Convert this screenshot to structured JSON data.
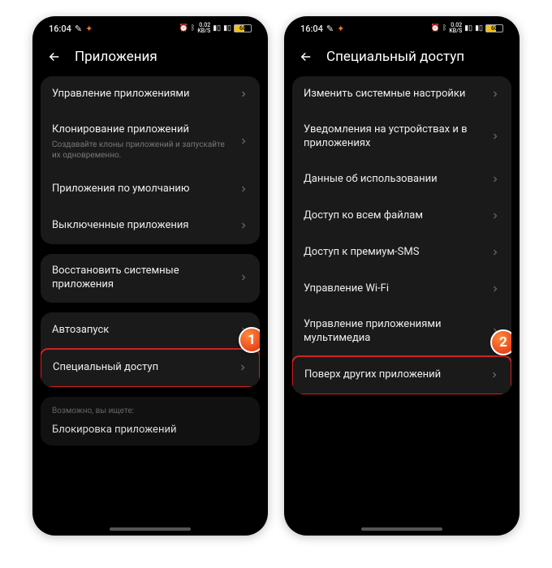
{
  "status": {
    "time": "16:04",
    "speed_top": "0.02",
    "speed_bot": "KB/S",
    "battery": "60"
  },
  "screen1": {
    "title": "Приложения",
    "group1": [
      {
        "label": "Управление приложениями"
      },
      {
        "label": "Клонирование приложений",
        "sub": "Создавайте клоны приложений и запускайте их одновременно."
      },
      {
        "label": "Приложения по умолчанию"
      },
      {
        "label": "Выключенные приложения"
      }
    ],
    "group2": [
      {
        "label": "Восстановить системные приложения"
      }
    ],
    "group3": [
      {
        "label": "Автозапуск"
      },
      {
        "label": "Специальный доступ",
        "highlight": true
      }
    ],
    "suggest_label": "Возможно, вы ищете:",
    "suggest_item": "Блокировка приложений",
    "badge": "1"
  },
  "screen2": {
    "title": "Специальный доступ",
    "items": [
      {
        "label": "Изменить системные настройки"
      },
      {
        "label": "Уведомления на устройствах и в приложениях"
      },
      {
        "label": "Данные об использовании"
      },
      {
        "label": "Доступ ко всем файлам"
      },
      {
        "label": "Доступ к премиум-SMS"
      },
      {
        "label": "Управление Wi-Fi"
      },
      {
        "label": "Управление приложениями мультимедиа"
      },
      {
        "label": "Поверх других приложений",
        "highlight": true
      }
    ],
    "badge": "2"
  }
}
